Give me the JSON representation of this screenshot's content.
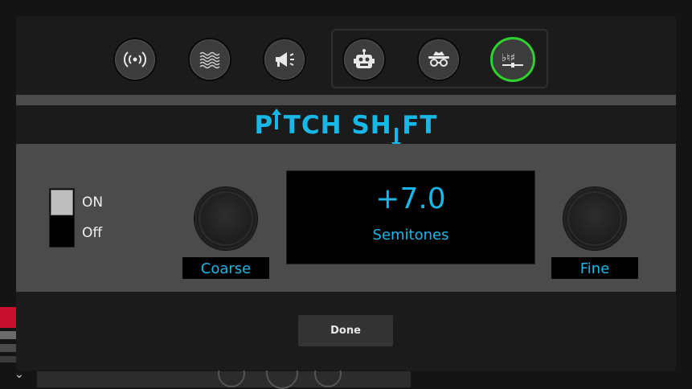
{
  "effects": {
    "buttons": [
      {
        "name": "reverb-effect",
        "icon": "broadcast-waves-icon",
        "active": false
      },
      {
        "name": "distortion-effect",
        "icon": "chain-link-mesh-icon",
        "active": false
      },
      {
        "name": "megaphone-effect",
        "icon": "megaphone-icon",
        "active": false
      },
      {
        "name": "robot-effect",
        "icon": "robot-icon",
        "active": false
      },
      {
        "name": "disguise-effect",
        "icon": "spy-disguise-icon",
        "active": false
      },
      {
        "name": "pitch-shift-effect",
        "icon": "flat-natural-sharp-icon",
        "active": true
      }
    ],
    "active_color": "#2fd12f"
  },
  "title": "PITCH SHIFT",
  "title_parts": {
    "left": "P",
    "i1": "I",
    "mid": "TCH SH",
    "i2": "I",
    "right": "FT"
  },
  "power": {
    "on_label": "ON",
    "off_label": "Off",
    "state": "ON"
  },
  "coarse": {
    "label": "Coarse"
  },
  "fine": {
    "label": "Fine"
  },
  "display": {
    "value": "+7.0",
    "unit": "Semitones"
  },
  "done_label": "Done",
  "colors": {
    "accent": "#19b7e6",
    "panel": "#4b4b4b",
    "modal": "#1b1b1b"
  }
}
